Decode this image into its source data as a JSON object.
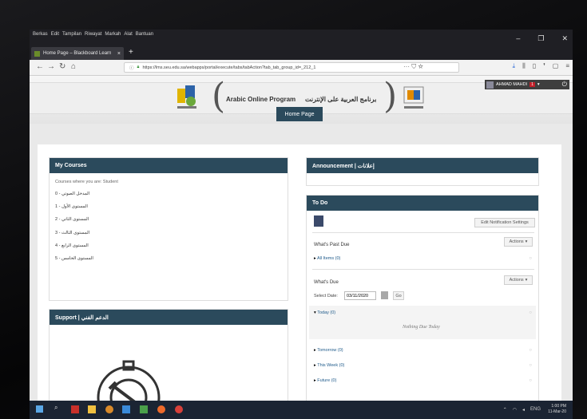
{
  "menu": {
    "items": [
      "Berkas",
      "Edit",
      "Tampilan",
      "Riwayat",
      "Markah",
      "Alat",
      "Bantuan"
    ]
  },
  "tab": {
    "title": "Home Page – Blackboard Learn",
    "close": "×",
    "new": "+"
  },
  "url": {
    "value": "https://lms.seu.edu.sa/webapps/portal/execute/tabs/tabAction?tab_tab_group_id=_212_1",
    "more": "···"
  },
  "header": {
    "program_en": "Arabic Online Program",
    "program_ar": "برنامج العربية على الإنترنت",
    "home_tab": "Home Page",
    "user_name": "AHMAD MAHDI",
    "badge": "1"
  },
  "my_courses": {
    "title": "My Courses",
    "caption": "Courses where you are: Student",
    "courses": [
      "المدخل الصوتي - 0",
      "المستوى الأول - 1",
      "المستوى الثاني - 2",
      "المستوى الثالث - 3",
      "المستوى الرابع - 4",
      "المستوى الخامس - 5"
    ]
  },
  "support": {
    "title": "Support | الدعم الفني"
  },
  "announcement": {
    "title": "Announcement | إعلانات"
  },
  "todo": {
    "title": "To Do",
    "edit_button": "Edit Notification Settings",
    "past_due": {
      "heading": "What's Past Due",
      "actions": "Actions",
      "item": "All Items (0)"
    },
    "due": {
      "heading": "What's Due",
      "actions": "Actions",
      "select_label": "Select Date:",
      "date_value": "03/11/2020",
      "go": "Go",
      "today": "Today (0)",
      "nothing": "Nothing Due Today",
      "tomorrow": "Tomorrow (0)",
      "this_week": "This Week (0)",
      "future": "Future (0)"
    }
  },
  "tray": {
    "lang": "ENG",
    "time": "1:00 PM",
    "date": "11-Mar-20"
  },
  "colors": {
    "module_header": "#2b4a5c",
    "link": "#1e5a8a"
  }
}
